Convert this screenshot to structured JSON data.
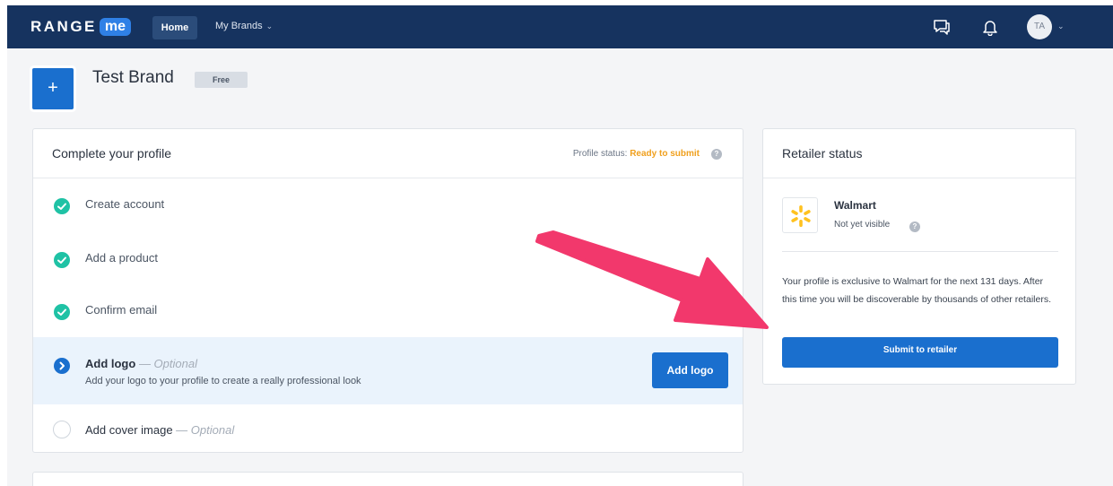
{
  "header": {
    "logo_range": "RANGE",
    "logo_me": "me",
    "nav_home": "Home",
    "nav_brands": "My Brands",
    "avatar_initials": "TA"
  },
  "brand": {
    "add_button": "+",
    "name": "Test Brand",
    "plan": "Free"
  },
  "profile_card": {
    "title": "Complete your profile",
    "status_label": "Profile status: ",
    "status_value": "Ready to submit",
    "help": "?",
    "steps": [
      {
        "label": "Create account",
        "state": "done"
      },
      {
        "label": "Add a product",
        "state": "done"
      },
      {
        "label": "Confirm email",
        "state": "done"
      },
      {
        "label": "Add logo",
        "optional": " — Optional",
        "description": "Add your logo to your profile to create a really professional look",
        "state": "current",
        "button": "Add logo"
      },
      {
        "label": "Add cover image",
        "optional": " — Optional",
        "state": "todo"
      }
    ]
  },
  "retailer_card": {
    "title": "Retailer status",
    "retailer_name": "Walmart",
    "visibility": "Not yet visible",
    "help": "?",
    "description": "Your profile is exclusive to Walmart for the next 131 days. After this time you will be discoverable by thousands of other retailers.",
    "submit_button": "Submit to retailer"
  },
  "colors": {
    "topbar": "#16335f",
    "primary": "#1a6fce",
    "done": "#1fc2a5",
    "ready": "#f0a01e",
    "arrow": "#f2386c",
    "walmart_spark": "#ffc220"
  },
  "icons": [
    "chat-icon",
    "bell-icon",
    "check-icon",
    "chevron-right-icon",
    "walmart-spark-icon",
    "arrow-annotation"
  ]
}
